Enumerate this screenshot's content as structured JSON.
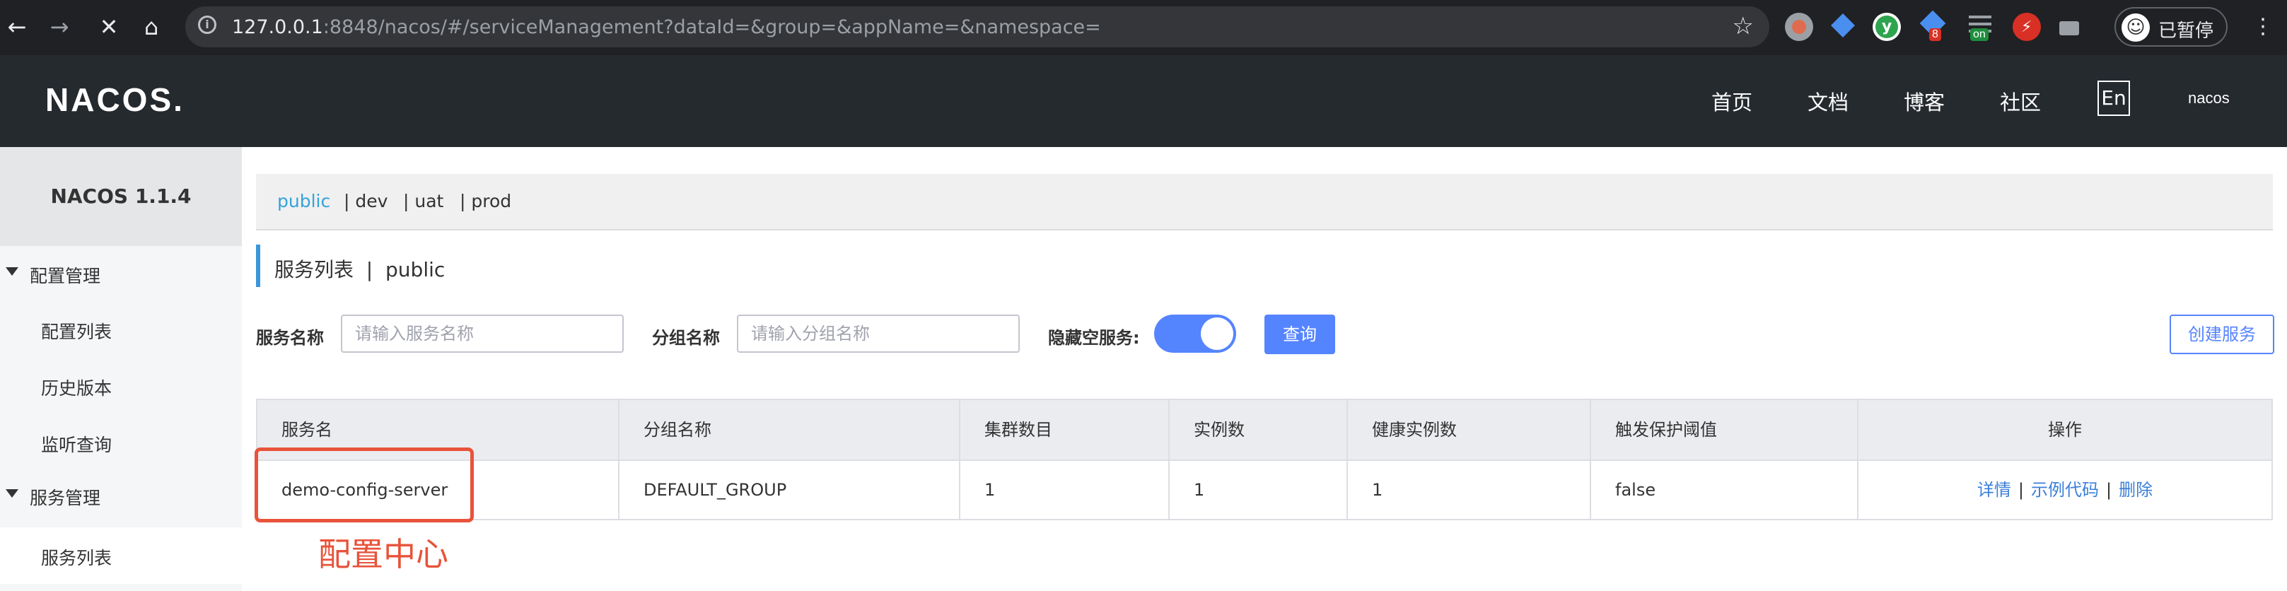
{
  "browser": {
    "url_host": "127.0.0.1",
    "url_rest": ":8848/nacos/#/serviceManagement?dataId=&group=&appName=&namespace=",
    "profile_label": "已暂停",
    "extensions": [
      {
        "name": "extension-red-circle-icon",
        "color": "#e06c4f"
      },
      {
        "name": "extension-diamond-icon",
        "color": "#4a8ff0"
      },
      {
        "name": "extension-green-y-icon",
        "color": "#2ea44f"
      },
      {
        "name": "extension-puzzle-icon",
        "color": "#4a8ff0",
        "badge": "8",
        "badge_color": "#d93025"
      },
      {
        "name": "extension-list-icon",
        "color": "#9aa0a6",
        "badge": "on",
        "badge_color": "#1e8e3e"
      },
      {
        "name": "extension-red-plug-icon",
        "color": "#d93025"
      },
      {
        "name": "extension-briefcase-icon",
        "color": "#9aa0a6"
      }
    ]
  },
  "header": {
    "logo": "NACOS.",
    "nav": [
      "首页",
      "文档",
      "博客",
      "社区"
    ],
    "lang": "En",
    "user": "nacos"
  },
  "sidebar": {
    "version": "NACOS 1.1.4",
    "groups": [
      {
        "label": "配置管理",
        "items": [
          "配置列表",
          "历史版本",
          "监听查询"
        ]
      },
      {
        "label": "服务管理",
        "items": [
          "服务列表"
        ]
      }
    ]
  },
  "namespaces": [
    "public",
    "| dev",
    "| uat",
    "| prod"
  ],
  "page": {
    "title": "服务列表  |  public"
  },
  "filters": {
    "service_label": "服务名称",
    "service_placeholder": "请输入服务名称",
    "group_label": "分组名称",
    "group_placeholder": "请输入分组名称",
    "hide_empty_label": "隐藏空服务:",
    "hide_empty_on": true,
    "query_label": "查询",
    "create_label": "创建服务"
  },
  "table": {
    "headers": [
      "服务名",
      "分组名称",
      "集群数目",
      "实例数",
      "健康实例数",
      "触发保护阈值",
      "操作"
    ],
    "rows": [
      {
        "service": "demo-config-server",
        "group": "DEFAULT_GROUP",
        "clusters": "1",
        "instances": "1",
        "healthy": "1",
        "protect": "false"
      }
    ],
    "ops": [
      "详情",
      "示例代码",
      "删除"
    ],
    "op_sep": "|"
  },
  "annotation": {
    "text": "配置中心",
    "color": "#e8533a"
  }
}
